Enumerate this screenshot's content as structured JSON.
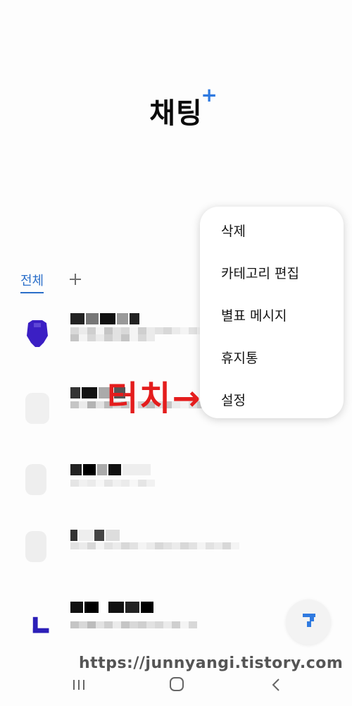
{
  "app": {
    "title": "채팅",
    "title_badge": "+"
  },
  "tabs": {
    "all_label": "전체",
    "add_icon": "plus-icon"
  },
  "overflow_menu": {
    "items": [
      {
        "label": "삭제"
      },
      {
        "label": "카테고리 편집"
      },
      {
        "label": "별표 메시지"
      },
      {
        "label": "휴지통"
      },
      {
        "label": "설정"
      }
    ]
  },
  "annotation": {
    "text": "터치→"
  },
  "watermark": {
    "text": "https://junnyangi.tistory.com"
  },
  "navbar": {
    "recents_icon": "recents-icon",
    "home_icon": "home-icon",
    "back_icon": "back-icon"
  },
  "colors": {
    "accent": "#2f7ae0",
    "tab_active": "#2b6fc9",
    "annotation": "#e41d1d",
    "avatar_purple": "#3b1fc4"
  }
}
